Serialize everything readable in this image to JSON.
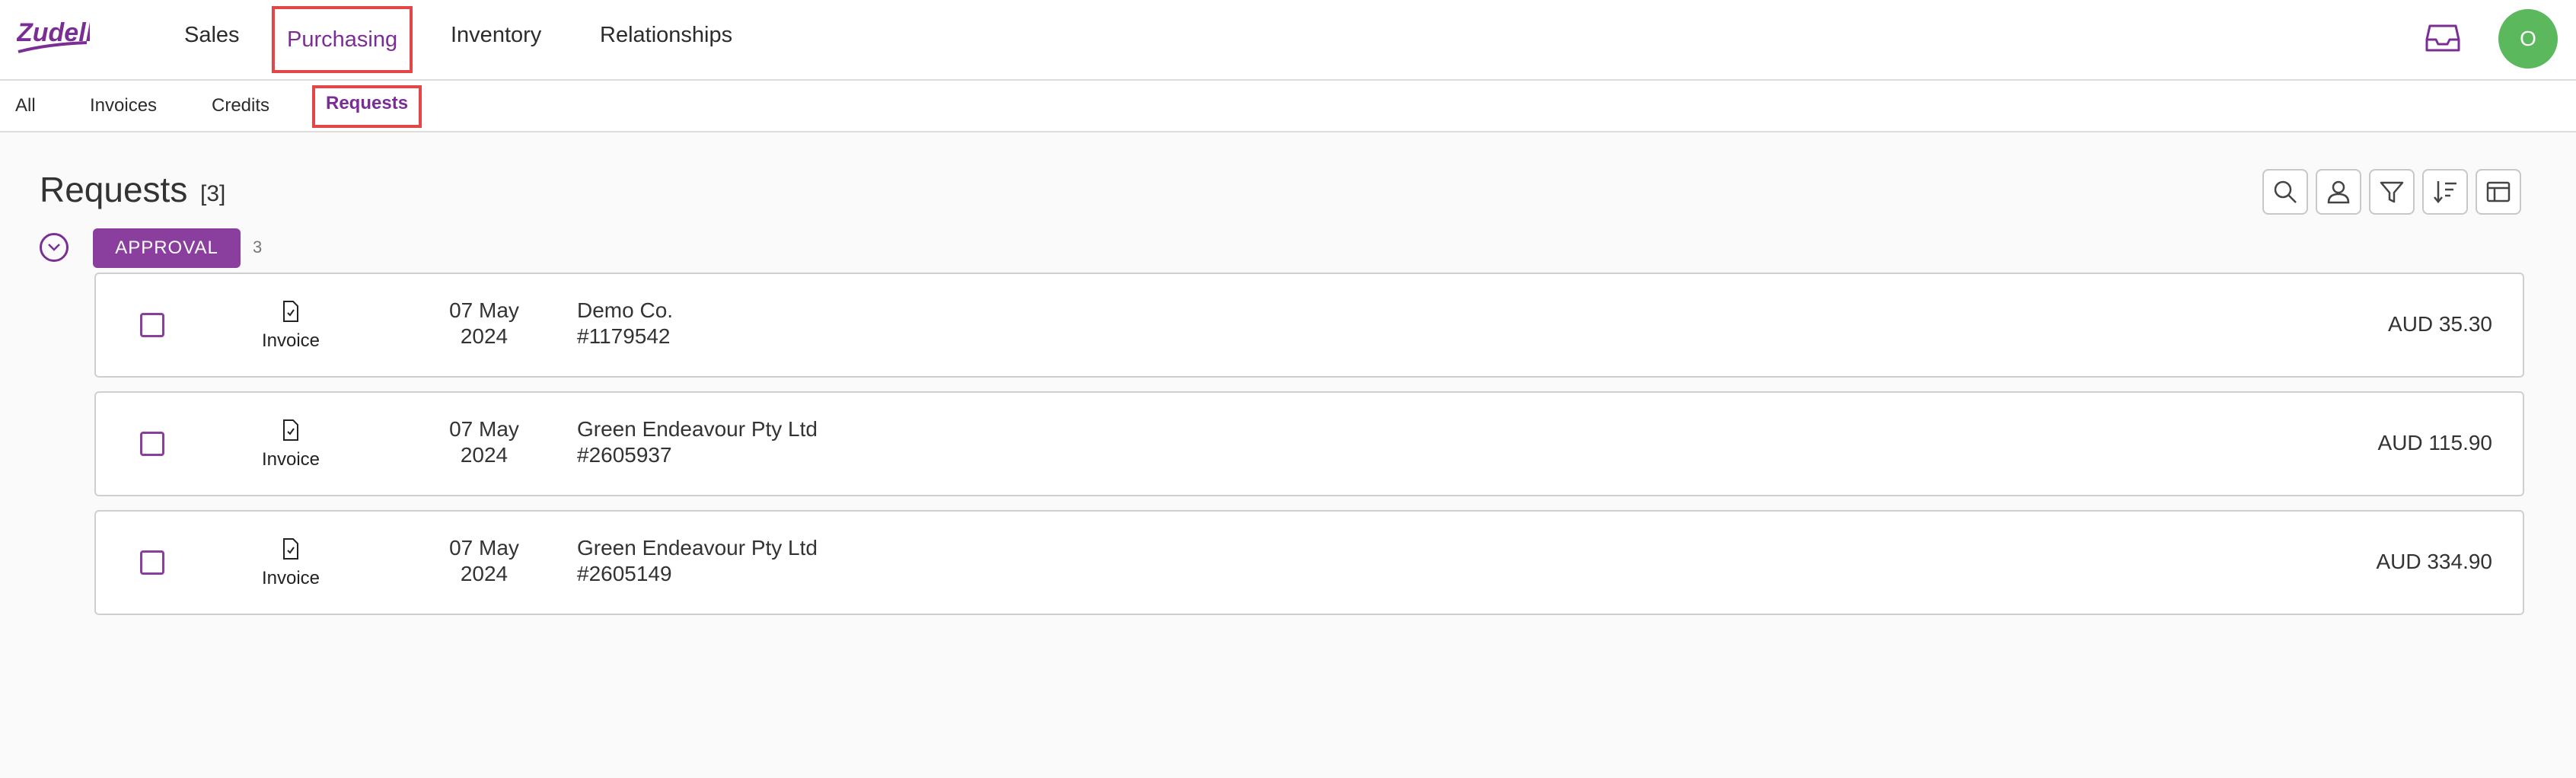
{
  "brand": {
    "logo_text": "Zudello",
    "accent": "#7b2d96",
    "highlight": "#e24646"
  },
  "nav": {
    "items": [
      {
        "label": "Sales"
      },
      {
        "label": "Purchasing",
        "active": true
      },
      {
        "label": "Inventory"
      },
      {
        "label": "Relationships"
      }
    ]
  },
  "header_right": {
    "inbox_icon": "inbox-icon",
    "avatar_initial": "O",
    "avatar_color": "#5cb85c"
  },
  "subnav": {
    "items": [
      {
        "label": "All"
      },
      {
        "label": "Invoices"
      },
      {
        "label": "Credits"
      },
      {
        "label": "Requests",
        "active": true
      }
    ]
  },
  "page": {
    "title": "Requests",
    "count": "[3]"
  },
  "toolbar": {
    "icons": [
      "search-icon",
      "user-icon",
      "filter-icon",
      "sort-icon",
      "columns-icon"
    ]
  },
  "group": {
    "label": "APPROVAL",
    "count": "3"
  },
  "rows": [
    {
      "type": "Invoice",
      "date_day": "07 May",
      "date_year": "2024",
      "supplier": "Demo Co.",
      "ref": "#1179542",
      "amount": "AUD 35.30"
    },
    {
      "type": "Invoice",
      "date_day": "07 May",
      "date_year": "2024",
      "supplier": "Green Endeavour Pty Ltd",
      "ref": "#2605937",
      "amount": "AUD 115.90"
    },
    {
      "type": "Invoice",
      "date_day": "07 May",
      "date_year": "2024",
      "supplier": "Green Endeavour Pty Ltd",
      "ref": "#2605149",
      "amount": "AUD 334.90"
    }
  ]
}
